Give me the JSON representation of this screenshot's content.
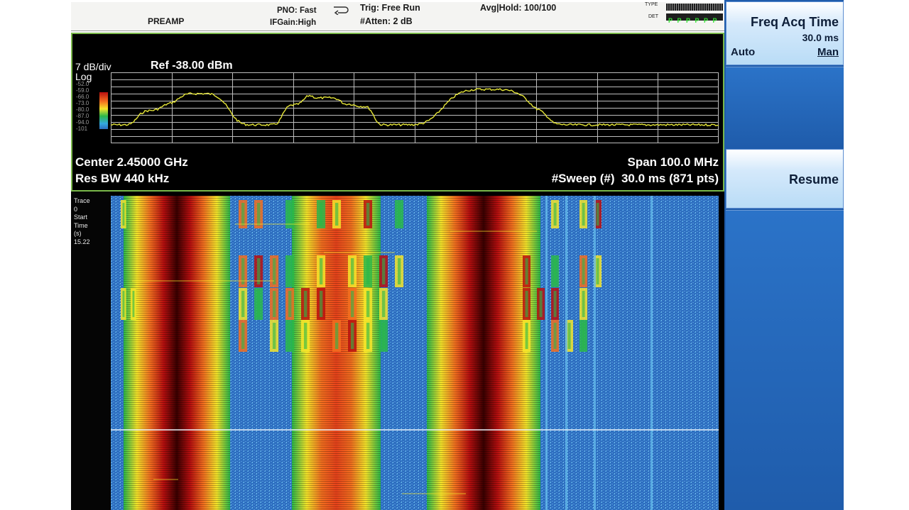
{
  "status_bar": {
    "preamp": "PREAMP",
    "pno": "PNO: Fast",
    "ifgain": "IFGain:High",
    "trig": "Trig: Free Run",
    "atten": "#Atten: 2 dB",
    "avg_hold": "Avg|Hold: 100/100",
    "type_label": "TYPE",
    "det_label": "DET",
    "det_values": [
      "P",
      "P",
      "P",
      "P",
      "P",
      "P"
    ]
  },
  "spectrum": {
    "scale": "7 dB/div",
    "ref": "Ref -38.00 dBm",
    "log": "Log",
    "scale_ticks": [
      "-52.0",
      "-59.0",
      "-66.0",
      "-73.0",
      "-80.0",
      "-87.0",
      "-94.0",
      "-101"
    ],
    "center": "Center 2.45000 GHz",
    "span": "Span 100.0 MHz",
    "res_bw": "Res BW 440 kHz",
    "sweep": "#Sweep (#)  30.0 ms (871 pts)",
    "trace_color": "#e5e538",
    "grid_color": "#bdbdbd",
    "border_color": "#7ab84a"
  },
  "waterfall": {
    "side_labels": [
      "Trace",
      "0",
      "Start",
      "Time",
      "(s)",
      "15.22"
    ],
    "background": "#2e6ec0"
  },
  "softkeys": {
    "freq_acq_title": "Freq Acq Time",
    "freq_acq_value": "30.0 ms",
    "auto": "Auto",
    "man": "Man",
    "resume": "Resume",
    "accent": "#1f5cab"
  }
}
